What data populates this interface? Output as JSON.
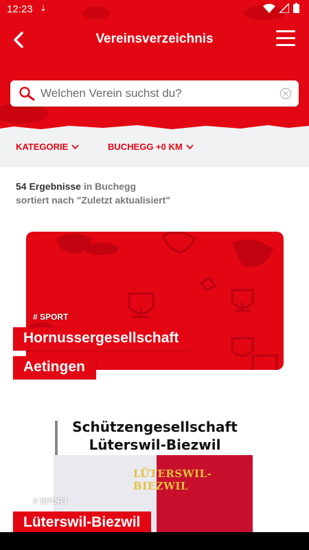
{
  "status": {
    "time": "12:23"
  },
  "appbar": {
    "title": "Vereinsverzeichnis"
  },
  "search": {
    "placeholder": "Welchen Verein suchst du?"
  },
  "filters": {
    "category": "KATEGORIE",
    "location": "BUCHEGG +0 KM"
  },
  "results": {
    "count": "54 Ergebnisse",
    "location": "in Buchegg",
    "sort": "sortiert nach \"Zuletzt aktualisiert\""
  },
  "cards": [
    {
      "tag": "# SPORT",
      "name_line1": "Hornussergesellschaft",
      "name_line2": "Aetingen"
    },
    {
      "tag": "# SPORT",
      "image_title_line1": "Schützengesellschaft",
      "image_title_line2": "Lüterswil-Biezwil",
      "banner_text": "LÜTERSWIL-BIEZWIL",
      "name_line1": "Lüterswil-Biezwil"
    }
  ],
  "colors": {
    "brand": "#e30613",
    "background": "#ffffff",
    "filter_bg": "#f1f2f3"
  }
}
